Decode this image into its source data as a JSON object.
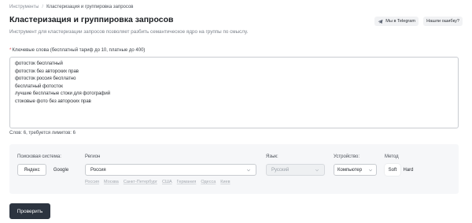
{
  "breadcrumb": {
    "root": "Инструменты",
    "separator": "/",
    "current": "Кластеризация и группировка запросов"
  },
  "header": {
    "title": "Кластеризация и группировка запросов",
    "subtitle": "Инструмент для кластеризации запросов позволяет разбить семантическое ядро на группы по смыслу.",
    "telegram_label": "Мы в Telegram",
    "report_label": "Нашли ошибку?"
  },
  "keywords": {
    "required_mark": "*",
    "label": "Ключевые слова (бесплатный тариф до 10, платные до 400)",
    "value": "фотосток бесплатный\nфотосток без авторских прав\nфотосток россия бесплатно\nбесплатный фотосток\nлучшие бесплатные стоки для фотографий\nстоковые фото без авторских прав",
    "count_text": "Слов: 6, требуется лимитов: 6"
  },
  "settings": {
    "engine": {
      "label": "Поисковая система:",
      "options": [
        "Яндекс",
        "Google"
      ],
      "selected": "Яндекс"
    },
    "region": {
      "label": "Регион",
      "value": "Россия",
      "quick": [
        "Россия",
        "Москва",
        "Санкт-Петербург",
        "США",
        "Германия",
        "Одесса",
        "Киев"
      ]
    },
    "language": {
      "label": "Язык:",
      "value": "Русский"
    },
    "device": {
      "label": "Устройство:",
      "value": "Компьютер"
    },
    "method": {
      "label": "Метод",
      "options": [
        "Soft",
        "Hard"
      ],
      "selected": "Soft"
    }
  },
  "submit_label": "Проверить",
  "colors": {
    "primary_button": "#2c3440",
    "telegram": "#5a6270",
    "required": "#e5484d",
    "panel_bg": "#f6f7f9"
  }
}
